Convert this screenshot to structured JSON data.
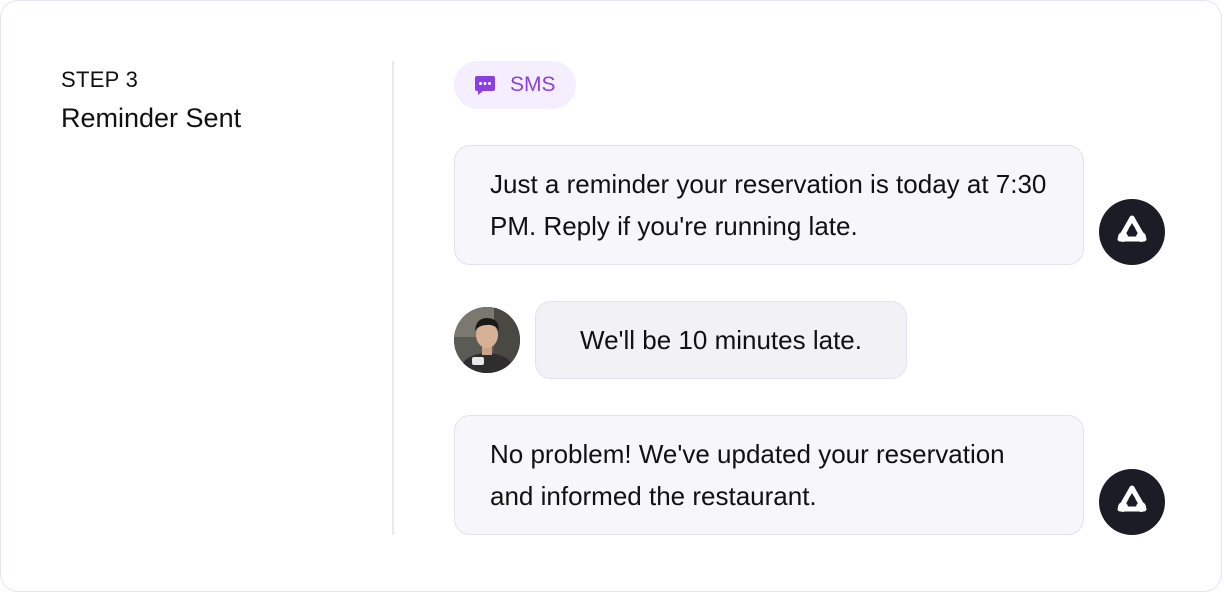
{
  "step": {
    "label": "STEP 3",
    "title": "Reminder Sent"
  },
  "channel": {
    "icon": "chat-bubble-icon",
    "label": "SMS",
    "accent_color": "#8a3fe0",
    "pill_background": "#f4eefe"
  },
  "messages": [
    {
      "sender": "agent",
      "text": "Just a reminder your reservation is today at 7:30 PM. Reply if you're running late."
    },
    {
      "sender": "user",
      "text": "We'll be 10 minutes late."
    },
    {
      "sender": "agent",
      "text": "No problem! We've updated your reservation and informed the restaurant."
    }
  ],
  "avatars": {
    "agent_icon": "brand-logo-icon",
    "agent_background": "#1c1c26",
    "user_icon": "user-photo"
  }
}
